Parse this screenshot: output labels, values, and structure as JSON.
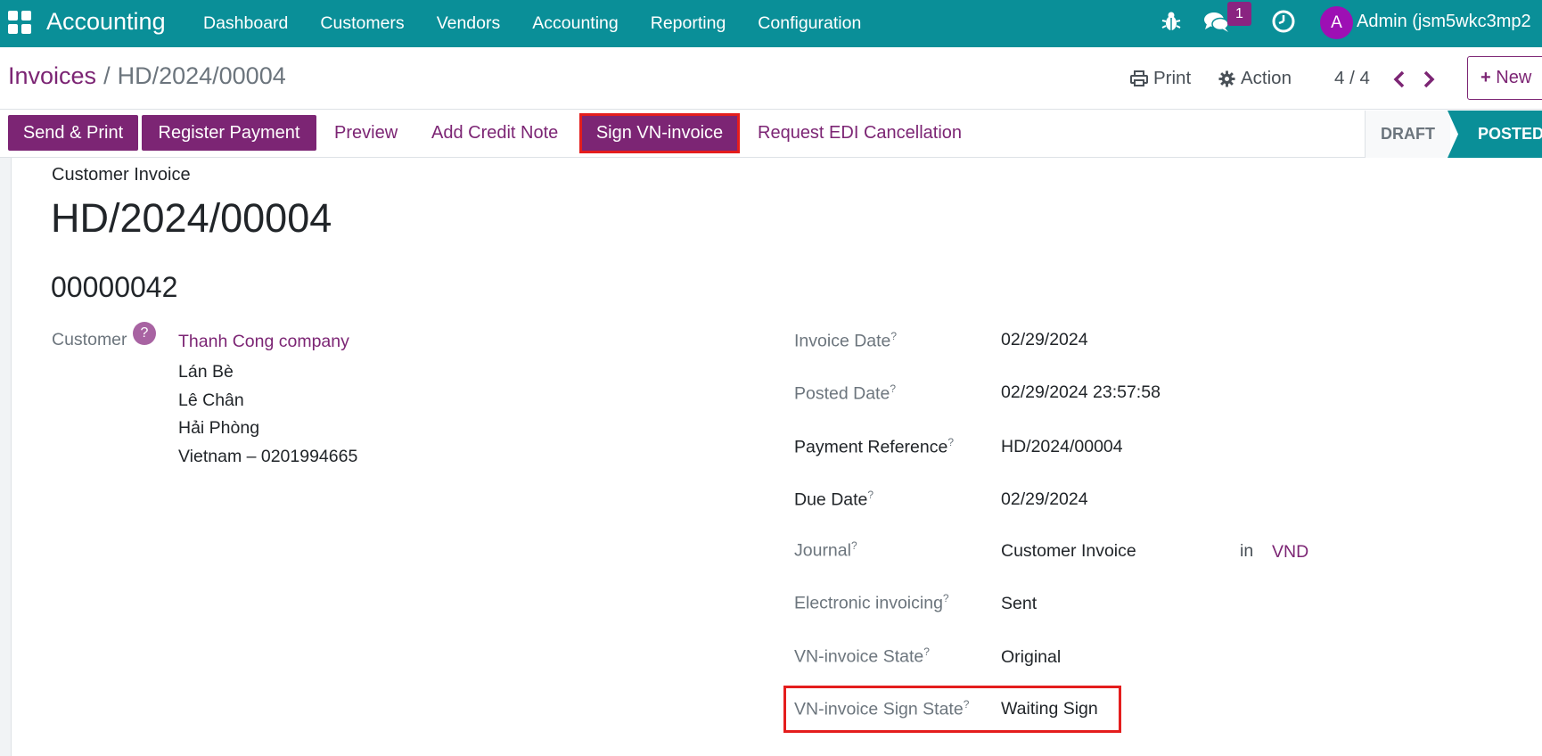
{
  "navbar": {
    "app_title": "Accounting",
    "menu": [
      "Dashboard",
      "Customers",
      "Vendors",
      "Accounting",
      "Reporting",
      "Configuration"
    ],
    "chat_badge": "1",
    "avatar_letter": "A",
    "user_name": "Admin (jsm5wkc3mp2"
  },
  "control": {
    "breadcrumb_parent": "Invoices",
    "breadcrumb_separator": "/",
    "breadcrumb_current": "HD/2024/00004",
    "print_label": "Print",
    "action_label": "Action",
    "pager": "4 / 4",
    "new_label": "New"
  },
  "buttons": {
    "send_print": "Send & Print",
    "register_payment": "Register Payment",
    "preview": "Preview",
    "add_credit_note": "Add Credit Note",
    "sign_vn_invoice": "Sign VN-invoice",
    "request_edi_cancellation": "Request EDI Cancellation"
  },
  "status": {
    "draft": "DRAFT",
    "posted": "POSTED"
  },
  "invoice": {
    "doc_type": "Customer Invoice",
    "name": "HD/2024/00004",
    "number": "00000042",
    "customer_label": "Customer",
    "customer_help": "?",
    "customer_name": "Thanh Cong company",
    "address": [
      "Lán Bè",
      "Lê Chân",
      "Hải Phòng",
      "Vietnam – 0201994665"
    ],
    "fields": {
      "invoice_date_label": "Invoice Date",
      "invoice_date": "02/29/2024",
      "posted_date_label": "Posted Date",
      "posted_date": "02/29/2024 23:57:58",
      "payment_reference_label": "Payment Reference",
      "payment_reference": "HD/2024/00004",
      "due_date_label": "Due Date",
      "due_date": "02/29/2024",
      "journal_label": "Journal",
      "journal": "Customer Invoice",
      "journal_in": "in",
      "currency": "VND",
      "electronic_invoicing_label": "Electronic invoicing",
      "electronic_invoicing": "Sent",
      "vn_invoice_state_label": "VN-invoice State",
      "vn_invoice_state": "Original",
      "vn_invoice_sign_state_label": "VN-invoice Sign State",
      "vn_invoice_sign_state": "Waiting Sign",
      "help_mark": "?"
    }
  },
  "colors": {
    "navbar": "#0a8f98",
    "primary": "#7c2574",
    "highlight": "#e41d1d"
  }
}
